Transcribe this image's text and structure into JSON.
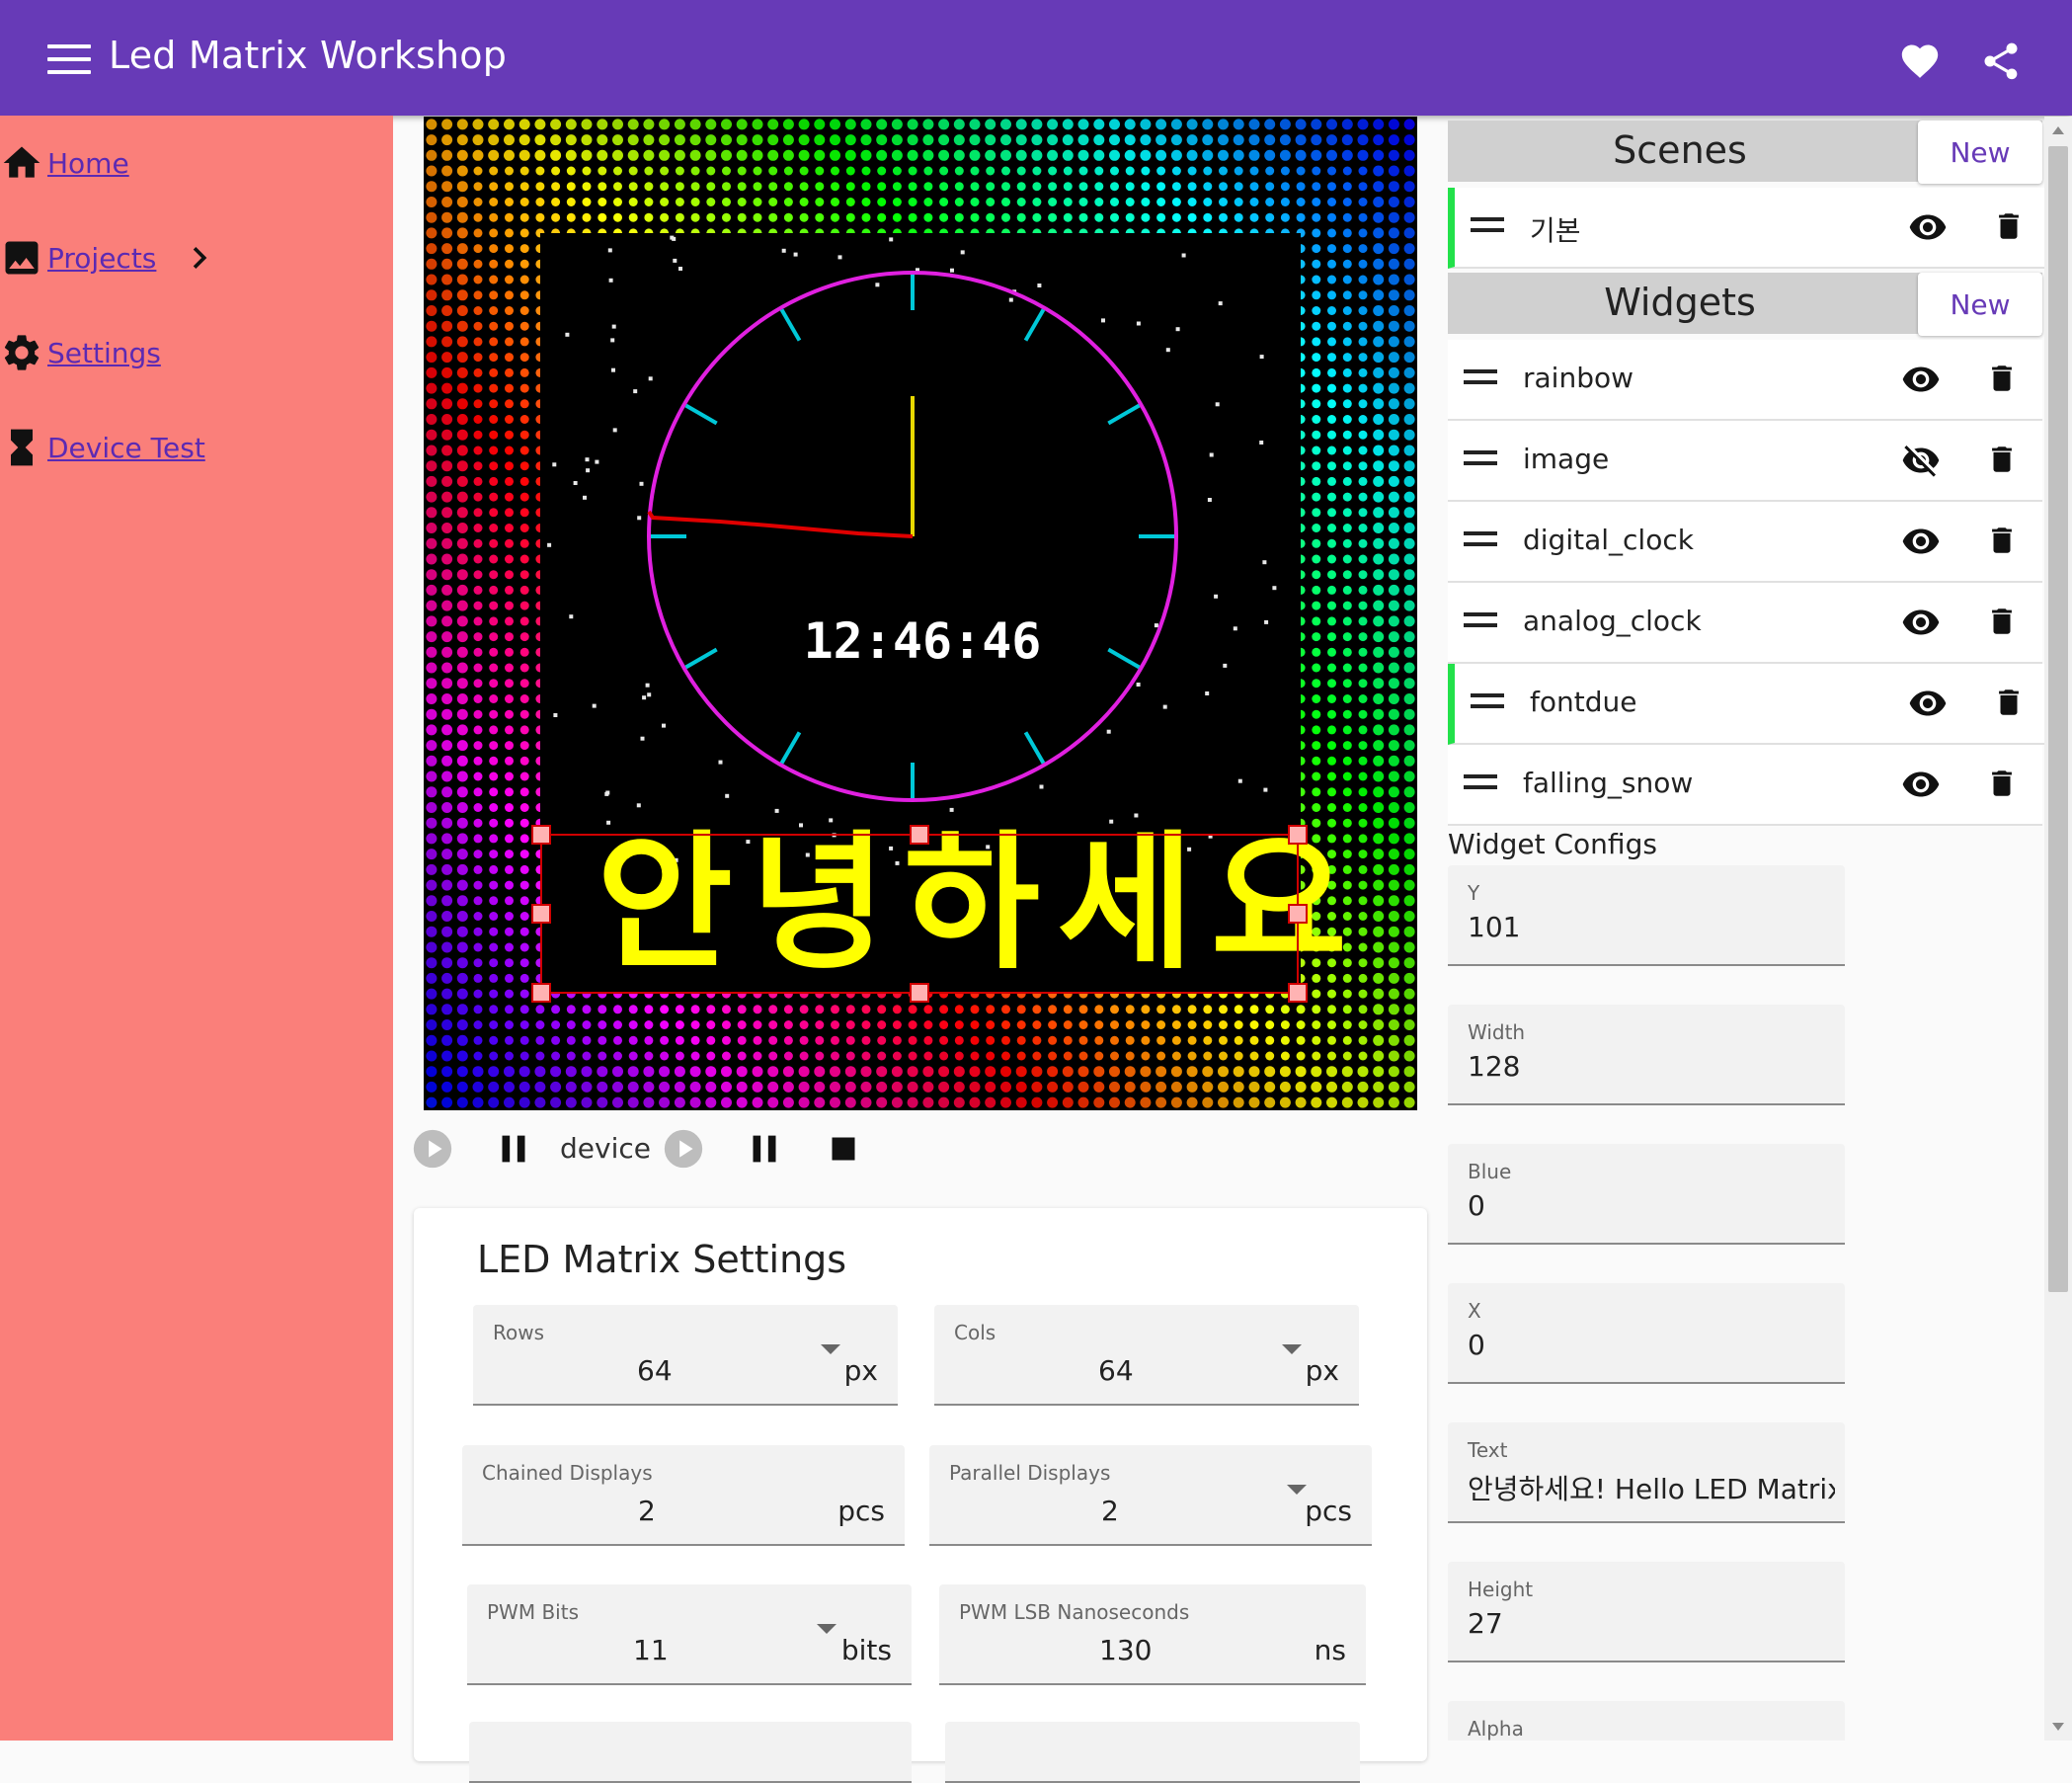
{
  "app": {
    "title": "Led Matrix Workshop"
  },
  "sidebar": {
    "items": [
      {
        "label": "Home",
        "icon": "home-icon"
      },
      {
        "label": "Projects",
        "icon": "image-icon"
      },
      {
        "label": "Settings",
        "icon": "gear-icon"
      },
      {
        "label": "Device Test",
        "icon": "hourglass-icon"
      }
    ]
  },
  "canvas": {
    "clock_text": "12:46:46",
    "banner_text": "안녕하세요"
  },
  "transport": {
    "device_label": "device"
  },
  "settings": {
    "title": "LED Matrix Settings",
    "rows": {
      "label": "Rows",
      "value": "64",
      "unit": "px"
    },
    "cols": {
      "label": "Cols",
      "value": "64",
      "unit": "px"
    },
    "chained": {
      "label": "Chained Displays",
      "value": "2",
      "unit": "pcs"
    },
    "parallel": {
      "label": "Parallel Displays",
      "value": "2",
      "unit": "pcs"
    },
    "pwm_bits": {
      "label": "PWM Bits",
      "value": "11",
      "unit": "bits"
    },
    "pwm_lsb": {
      "label": "PWM LSB Nanoseconds",
      "value": "130",
      "unit": "ns"
    }
  },
  "scenes": {
    "title": "Scenes",
    "new_label": "New",
    "items": [
      {
        "label": "기본",
        "visible": true,
        "active": true
      }
    ]
  },
  "widgets": {
    "title": "Widgets",
    "new_label": "New",
    "items": [
      {
        "label": "rainbow",
        "visible": true,
        "active": false
      },
      {
        "label": "image",
        "visible": false,
        "active": false
      },
      {
        "label": "digital_clock",
        "visible": true,
        "active": false
      },
      {
        "label": "analog_clock",
        "visible": true,
        "active": false
      },
      {
        "label": "fontdue",
        "visible": true,
        "active": true
      },
      {
        "label": "falling_snow",
        "visible": true,
        "active": false
      }
    ]
  },
  "widget_configs": {
    "title": "Widget Configs",
    "fields": [
      {
        "label": "Y",
        "value": "101"
      },
      {
        "label": "Width",
        "value": "128"
      },
      {
        "label": "Blue",
        "value": "0"
      },
      {
        "label": "X",
        "value": "0"
      },
      {
        "label": "Text",
        "value": "안녕하세요! Hello LED Matrix!!"
      },
      {
        "label": "Height",
        "value": "27"
      },
      {
        "label": "Alpha",
        "value": ""
      }
    ]
  },
  "colors": {
    "appbar": "#673ab7",
    "sidebar": "#fa7f7a",
    "accent": "#673ab7",
    "active_marker": "#22e14a",
    "clock_face": "#e020e0",
    "clock_ticks": "#00c8d8",
    "banner_text": "#ffff00"
  }
}
